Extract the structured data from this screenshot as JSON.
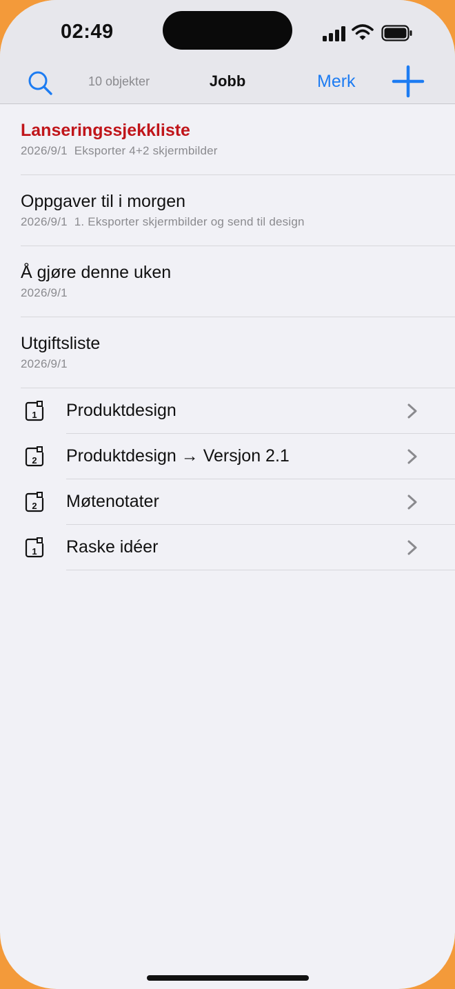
{
  "status_bar": {
    "time": "02:49"
  },
  "nav": {
    "count": "10 objekter",
    "title": "Jobb",
    "select_label": "Merk"
  },
  "notes": [
    {
      "title": "Lanseringssjekkliste",
      "date": "2026/9/1",
      "preview": "Eksporter 4+2 skjermbilder",
      "highlighted": true
    },
    {
      "title": "Oppgaver til i morgen",
      "date": "2026/9/1",
      "preview": "1. Eksporter skjermbilder og send til design"
    },
    {
      "title": "Å gjøre denne uken",
      "date": "2026/9/1",
      "preview": ""
    },
    {
      "title": "Utgiftsliste",
      "date": "2026/9/1",
      "preview": ""
    }
  ],
  "folders": [
    {
      "label": "Produktdesign",
      "badge": "1"
    },
    {
      "label": "Produktdesign → Versjon 2.1",
      "badge": "2"
    },
    {
      "label": "Møtenotater",
      "badge": "2"
    },
    {
      "label": "Raske idéer",
      "badge": "1"
    }
  ],
  "colors": {
    "accent": "#1d7cf2",
    "highlight_title": "#c0151a",
    "background": "#f1f1f6",
    "outer": "#f39a3a"
  },
  "icons": [
    "search-icon",
    "plus-icon",
    "folder-icon",
    "chevron-right-icon",
    "signal-icon",
    "wifi-icon",
    "battery-icon"
  ]
}
